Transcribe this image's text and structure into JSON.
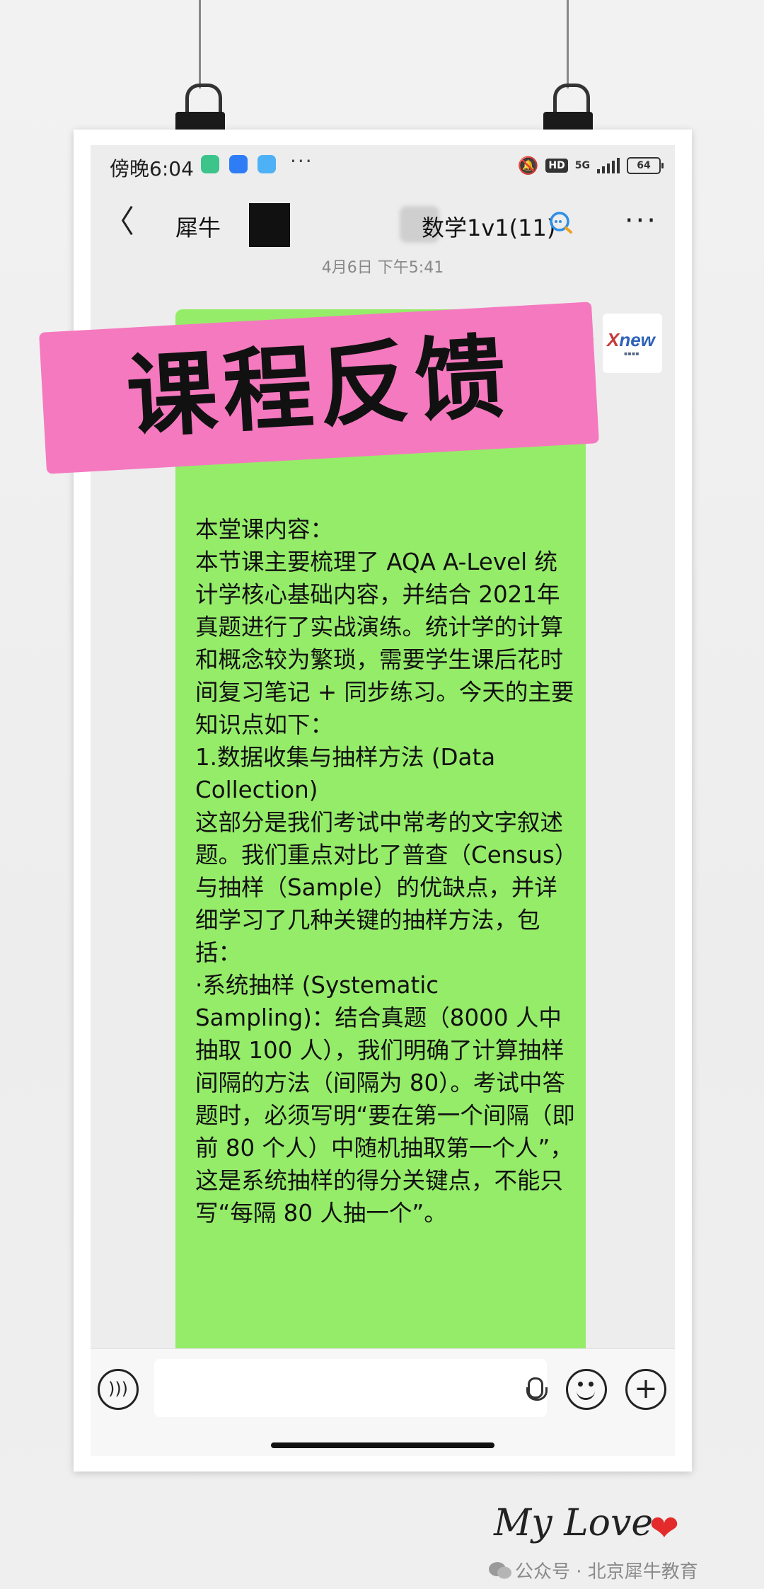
{
  "status_bar": {
    "time": "傍晚6:04",
    "more": "···",
    "network": "5G",
    "hd": "HD",
    "battery": "64"
  },
  "header": {
    "back": "〈",
    "title_prefix": "犀牛",
    "title_suffix": "数学1v1(11)",
    "more": "···"
  },
  "timestamp": "4月6日 下午5:41",
  "stamp": "课程反馈",
  "avatar": {
    "logo": "X",
    "logo_rest": "new"
  },
  "message": {
    "section_title": "本堂课内容：",
    "intro": "本节课主要梳理了 AQA A-Level 统计学核心基础内容，并结合 2021年真题进行了实战演练。统计学的计算和概念较为繁琐，需要学生课后花时间复习笔记 + 同步练习。今天的主要知识点如下：",
    "point1_title": "1.数据收集与抽样方法 (Data Collection)",
    "point1_body": "这部分是我们考试中常考的文字叙述题。我们重点对比了普查（Census）与抽样（Sample）的优缺点，并详细学习了几种关键的抽样方法，包括：",
    "bullet1": "·系统抽样 (Systematic Sampling)：结合真题（8000 人中抽取 100 人），我们明确了计算抽样间隔的方法（间隔为 80）。考试中答题时，必须写明“要在第一个间隔（即前 80 个人）中随机抽取第一个人”，这是系统抽样的得分关键点，不能只写“每隔 80 人抽一个”。"
  },
  "footer": {
    "signature": "My Love",
    "heart": "❤",
    "account": "公众号 · 北京犀牛教育"
  },
  "colors": {
    "bubble_green": "#95ec69",
    "stamp_pink": "#f579bf",
    "chat_bg": "#ededed"
  }
}
